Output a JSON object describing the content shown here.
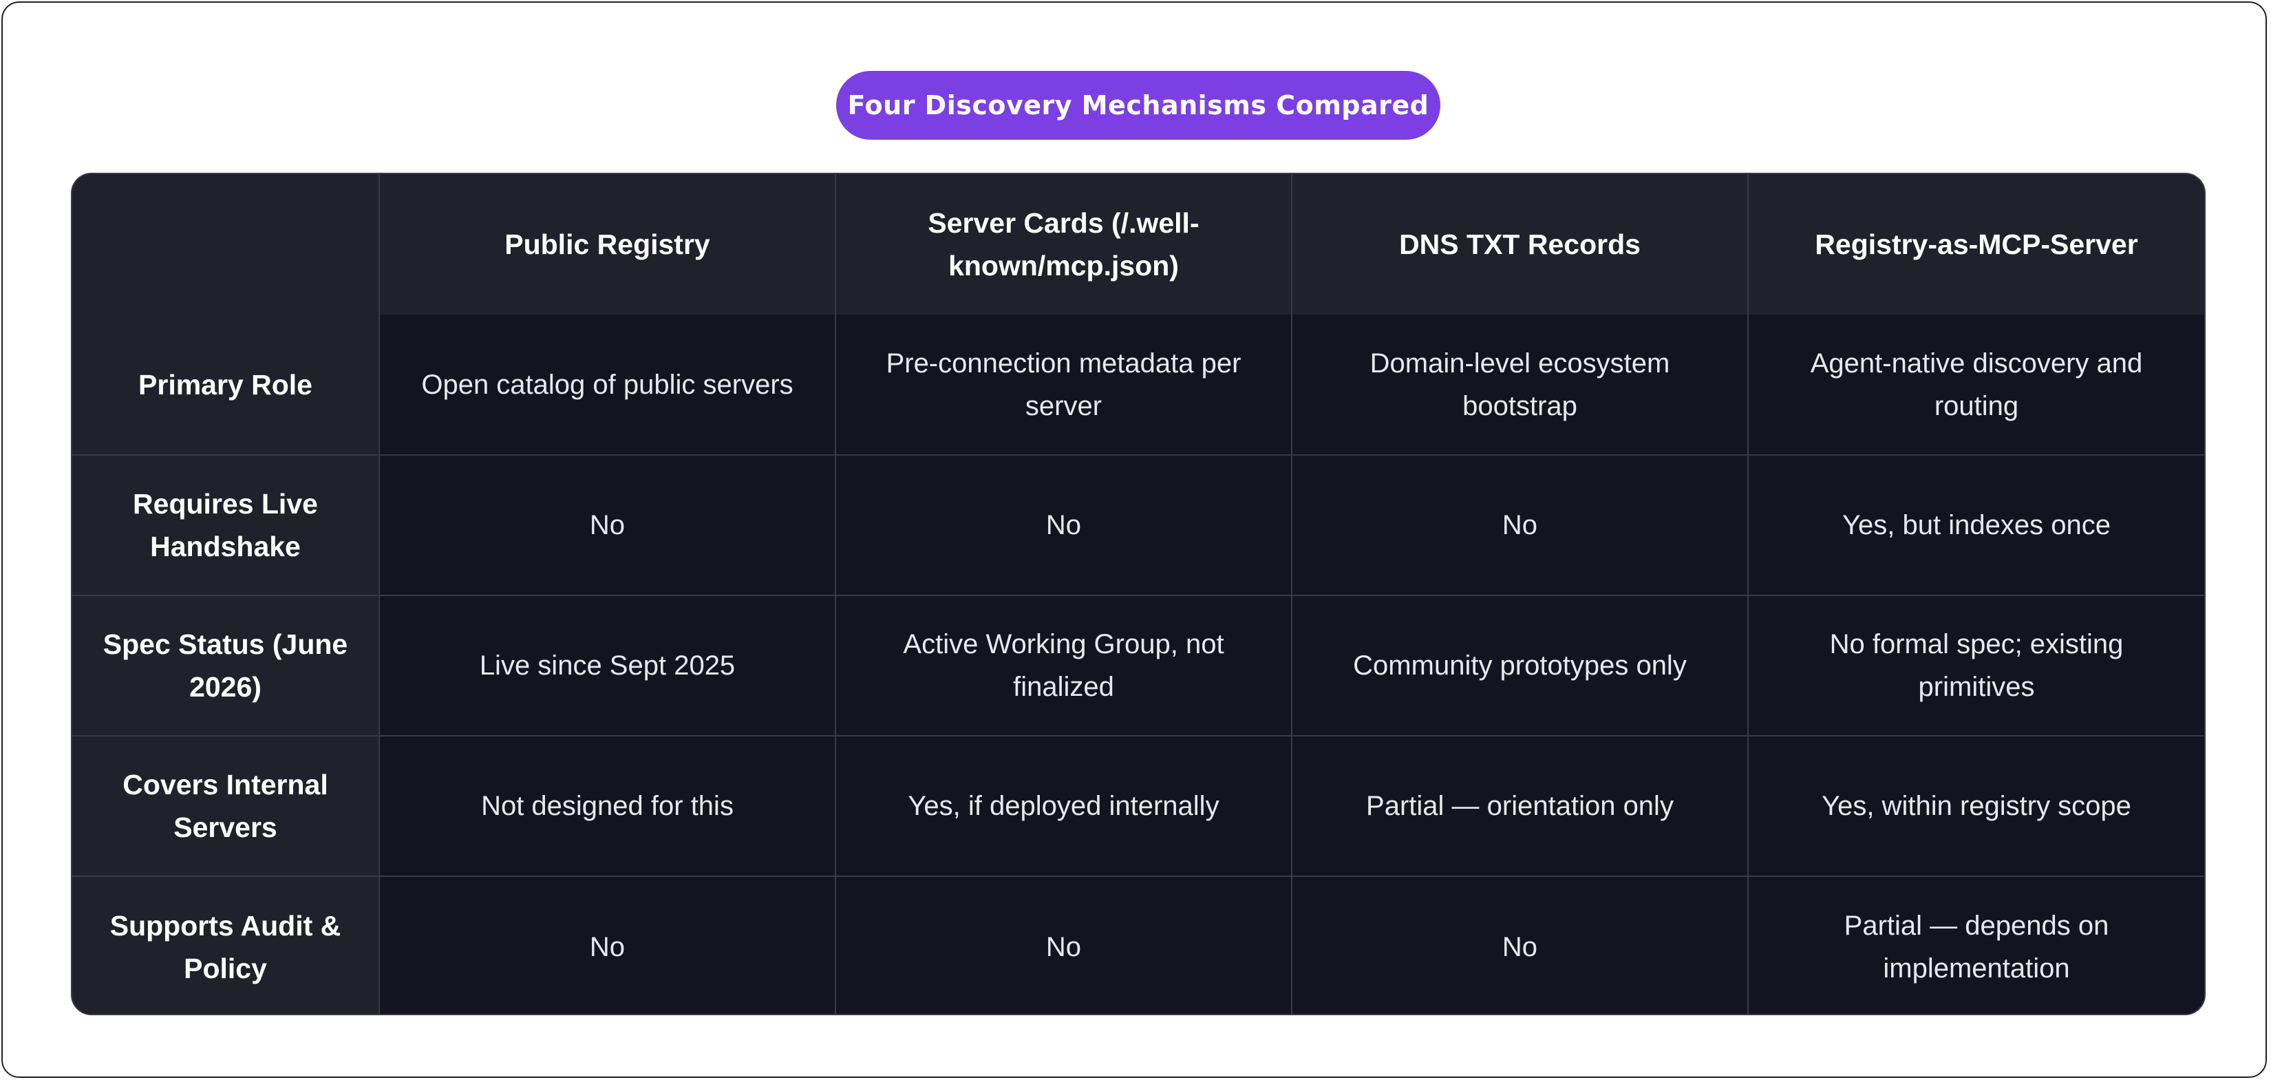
{
  "title": "Four Discovery Mechanisms Compared",
  "table": {
    "corner": "",
    "columns": [
      "Public Registry",
      "Server Cards (/.well-known/mcp.json)",
      "DNS TXT Records",
      "Registry-as-MCP-Server"
    ],
    "rows": [
      {
        "label": "Primary Role",
        "cells": [
          "Open catalog of public servers",
          "Pre-connection metadata per server",
          "Domain-level ecosystem bootstrap",
          "Agent-native discovery and routing"
        ]
      },
      {
        "label": "Requires Live Handshake",
        "cells": [
          "No",
          "No",
          "No",
          "Yes, but indexes once"
        ]
      },
      {
        "label": "Spec Status (June 2026)",
        "cells": [
          "Live since Sept 2025",
          "Active Working Group, not finalized",
          "Community prototypes only",
          "No formal spec; existing primitives"
        ]
      },
      {
        "label": "Covers Internal Servers",
        "cells": [
          "Not designed for this",
          "Yes, if deployed internally",
          "Partial — orientation only",
          "Yes, within registry scope"
        ]
      },
      {
        "label": "Supports Audit & Policy",
        "cells": [
          "No",
          "No",
          "No",
          "Partial — depends on implementation"
        ]
      }
    ]
  },
  "colors": {
    "accent": "#7b3fe4",
    "header_bg": "#20212b",
    "cell_bg": "#141420",
    "grid": "#3a3a46",
    "frame": "#222222"
  }
}
